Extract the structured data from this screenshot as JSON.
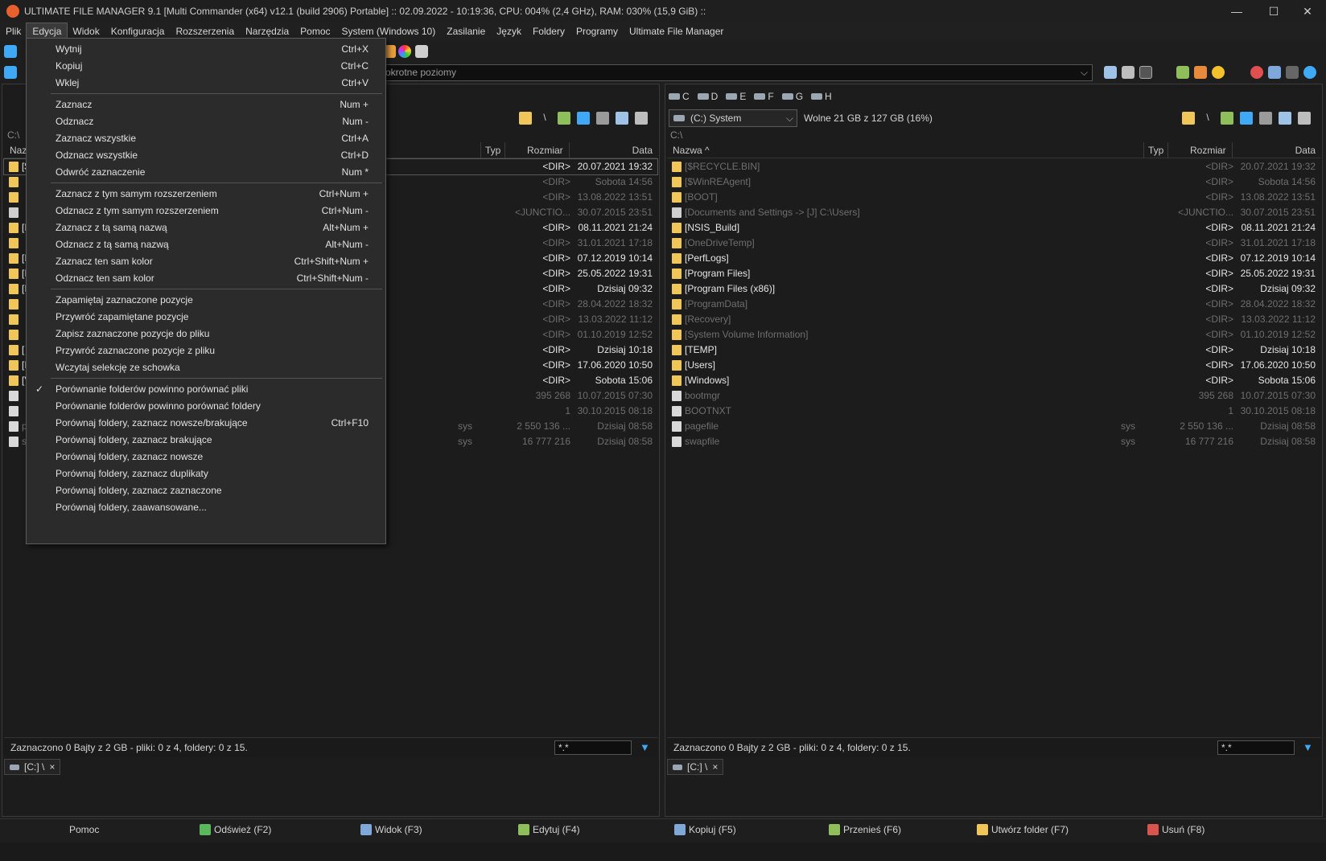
{
  "titlebar": {
    "title": "ULTIMATE FILE MANAGER 9.1 [Multi Commander (x64)  v12.1 (build 2906) Portable] :: 02.09.2022 - 10:19:36, CPU: 004% (2,4 GHz), RAM: 030% (15,9 GiB) ::",
    "minimize": "—",
    "maximize": "☐",
    "close": "✕"
  },
  "menubar": [
    "Plik",
    "Edycja",
    "Widok",
    "Konfiguracja",
    "Rozszerzenia",
    "Narzędzia",
    "Pomoc",
    "System (Windows 10)",
    "Zasilanie",
    "Język",
    "Foldery",
    "Programy",
    "Ultimate File Manager"
  ],
  "address": {
    "text": "okrotne poziomy"
  },
  "left_panel": {
    "path": "C:\\",
    "headers": {
      "name": "Naz",
      "type": "Typ",
      "size": "Rozmiar",
      "date": "Data"
    },
    "rows": [
      {
        "name": "[$",
        "type": "",
        "size": "<DIR>",
        "date": "20.07.2021 19:32",
        "style": "bright",
        "icon": "folder"
      },
      {
        "name": "",
        "type": "",
        "size": "<DIR>",
        "date": "Sobota 14:56",
        "style": "dim",
        "icon": "folder"
      },
      {
        "name": "",
        "type": "",
        "size": "<DIR>",
        "date": "13.08.2022 13:51",
        "style": "dim",
        "icon": "folder"
      },
      {
        "name": "",
        "type": "",
        "size": "<JUNCTIO...",
        "date": "30.07.2015 23:51",
        "style": "dim",
        "icon": "link"
      },
      {
        "name": "[I",
        "type": "",
        "size": "<DIR>",
        "date": "08.11.2021 21:24",
        "style": "bright",
        "icon": "folder"
      },
      {
        "name": "",
        "type": "",
        "size": "<DIR>",
        "date": "31.01.2021 17:18",
        "style": "dim",
        "icon": "folder"
      },
      {
        "name": "[I",
        "type": "",
        "size": "<DIR>",
        "date": "07.12.2019 10:14",
        "style": "bright",
        "icon": "folder"
      },
      {
        "name": "[I",
        "type": "",
        "size": "<DIR>",
        "date": "25.05.2022 19:31",
        "style": "bright",
        "icon": "folder"
      },
      {
        "name": "[I",
        "type": "",
        "size": "<DIR>",
        "date": "Dzisiaj 09:32",
        "style": "bright",
        "icon": "folder"
      },
      {
        "name": "",
        "type": "",
        "size": "<DIR>",
        "date": "28.04.2022 18:32",
        "style": "dim",
        "icon": "folder"
      },
      {
        "name": "",
        "type": "",
        "size": "<DIR>",
        "date": "13.03.2022 11:12",
        "style": "dim",
        "icon": "folder"
      },
      {
        "name": "",
        "type": "",
        "size": "<DIR>",
        "date": "01.10.2019 12:52",
        "style": "dim",
        "icon": "folder"
      },
      {
        "name": "[",
        "type": "",
        "size": "<DIR>",
        "date": "Dzisiaj 10:18",
        "style": "bright",
        "icon": "folder"
      },
      {
        "name": "[I",
        "type": "",
        "size": "<DIR>",
        "date": "17.06.2020 10:50",
        "style": "bright",
        "icon": "folder"
      },
      {
        "name": "[V",
        "type": "",
        "size": "<DIR>",
        "date": "Sobota 15:06",
        "style": "bright",
        "icon": "folder"
      },
      {
        "name": "",
        "type": "",
        "size": "395 268",
        "date": "10.07.2015 07:30",
        "style": "dim",
        "icon": "file"
      },
      {
        "name": "",
        "type": "",
        "size": "1",
        "date": "30.10.2015 08:18",
        "style": "dim",
        "icon": "file"
      },
      {
        "name": "p",
        "type": "sys",
        "size": "2 550 136 ...",
        "date": "Dzisiaj 08:58",
        "style": "dim",
        "icon": "file"
      },
      {
        "name": "s",
        "type": "sys",
        "size": "16 777 216",
        "date": "Dzisiaj 08:58",
        "style": "dim",
        "icon": "file"
      }
    ],
    "status": "Zaznaczono 0 Bajty z 2 GB - pliki: 0 z 4, foldery: 0 z 15.",
    "filter": "*.*",
    "tab": "[C:] \\",
    "tab_close": "×"
  },
  "right_panel": {
    "drives": [
      "C",
      "D",
      "E",
      "F",
      "G",
      "H"
    ],
    "drive_combo": "(C:) System",
    "free_space": "Wolne 21 GB z 127 GB (16%)",
    "path": "C:\\",
    "headers": {
      "name": "Nazwa ^",
      "type": "Typ",
      "size": "Rozmiar",
      "date": "Data"
    },
    "rows": [
      {
        "name": "[$RECYCLE.BIN]",
        "type": "",
        "size": "<DIR>",
        "date": "20.07.2021 19:32",
        "style": "dim",
        "icon": "folder"
      },
      {
        "name": "[$WinREAgent]",
        "type": "",
        "size": "<DIR>",
        "date": "Sobota 14:56",
        "style": "dim",
        "icon": "folder"
      },
      {
        "name": "[BOOT]",
        "type": "",
        "size": "<DIR>",
        "date": "13.08.2022 13:51",
        "style": "dim",
        "icon": "folder"
      },
      {
        "name": "[Documents and Settings ->  [J] C:\\Users]",
        "type": "",
        "size": "<JUNCTIO...",
        "date": "30.07.2015 23:51",
        "style": "dim",
        "icon": "link"
      },
      {
        "name": "[NSIS_Build]",
        "type": "",
        "size": "<DIR>",
        "date": "08.11.2021 21:24",
        "style": "bright",
        "icon": "folder"
      },
      {
        "name": "[OneDriveTemp]",
        "type": "",
        "size": "<DIR>",
        "date": "31.01.2021 17:18",
        "style": "dim",
        "icon": "folder"
      },
      {
        "name": "[PerfLogs]",
        "type": "",
        "size": "<DIR>",
        "date": "07.12.2019 10:14",
        "style": "bright",
        "icon": "folder"
      },
      {
        "name": "[Program Files]",
        "type": "",
        "size": "<DIR>",
        "date": "25.05.2022 19:31",
        "style": "bright",
        "icon": "folder"
      },
      {
        "name": "[Program Files (x86)]",
        "type": "",
        "size": "<DIR>",
        "date": "Dzisiaj 09:32",
        "style": "bright",
        "icon": "folder"
      },
      {
        "name": "[ProgramData]",
        "type": "",
        "size": "<DIR>",
        "date": "28.04.2022 18:32",
        "style": "dim",
        "icon": "folder"
      },
      {
        "name": "[Recovery]",
        "type": "",
        "size": "<DIR>",
        "date": "13.03.2022 11:12",
        "style": "dim",
        "icon": "folder"
      },
      {
        "name": "[System Volume Information]",
        "type": "",
        "size": "<DIR>",
        "date": "01.10.2019 12:52",
        "style": "dim",
        "icon": "folder"
      },
      {
        "name": "[TEMP]",
        "type": "",
        "size": "<DIR>",
        "date": "Dzisiaj 10:18",
        "style": "bright",
        "icon": "folder"
      },
      {
        "name": "[Users]",
        "type": "",
        "size": "<DIR>",
        "date": "17.06.2020 10:50",
        "style": "bright",
        "icon": "folder"
      },
      {
        "name": "[Windows]",
        "type": "",
        "size": "<DIR>",
        "date": "Sobota 15:06",
        "style": "bright",
        "icon": "folder"
      },
      {
        "name": "bootmgr",
        "type": "",
        "size": "395 268",
        "date": "10.07.2015 07:30",
        "style": "dim",
        "icon": "file"
      },
      {
        "name": "BOOTNXT",
        "type": "",
        "size": "1",
        "date": "30.10.2015 08:18",
        "style": "dim",
        "icon": "file"
      },
      {
        "name": "pagefile",
        "type": "sys",
        "size": "2 550 136 ...",
        "date": "Dzisiaj 08:58",
        "style": "dim",
        "icon": "file"
      },
      {
        "name": "swapfile",
        "type": "sys",
        "size": "16 777 216",
        "date": "Dzisiaj 08:58",
        "style": "dim",
        "icon": "file"
      }
    ],
    "status": "Zaznaczono 0 Bajty z 2 GB - pliki: 0 z 4, foldery: 0 z 15.",
    "filter": "*.*",
    "tab": "[C:] \\",
    "tab_close": "×"
  },
  "dropdown": {
    "groups": [
      [
        {
          "label": "Wytnij",
          "shortcut": "Ctrl+X"
        },
        {
          "label": "Kopiuj",
          "shortcut": "Ctrl+C"
        },
        {
          "label": "Wklej",
          "shortcut": "Ctrl+V"
        }
      ],
      [
        {
          "label": "Zaznacz",
          "shortcut": "Num +"
        },
        {
          "label": "Odznacz",
          "shortcut": "Num -"
        },
        {
          "label": "Zaznacz wszystkie",
          "shortcut": "Ctrl+A"
        },
        {
          "label": "Odznacz wszystkie",
          "shortcut": "Ctrl+D"
        },
        {
          "label": "Odwróć zaznaczenie",
          "shortcut": "Num *"
        }
      ],
      [
        {
          "label": "Zaznacz z tym samym rozszerzeniem",
          "shortcut": "Ctrl+Num +"
        },
        {
          "label": "Odznacz z tym samym rozszerzeniem",
          "shortcut": "Ctrl+Num -"
        },
        {
          "label": "Zaznacz z tą samą nazwą",
          "shortcut": "Alt+Num +"
        },
        {
          "label": "Odznacz z tą samą nazwą",
          "shortcut": "Alt+Num -"
        },
        {
          "label": "Zaznacz ten sam kolor",
          "shortcut": "Ctrl+Shift+Num +"
        },
        {
          "label": "Odznacz ten sam kolor",
          "shortcut": "Ctrl+Shift+Num -"
        }
      ],
      [
        {
          "label": "Zapamiętaj zaznaczone pozycje",
          "shortcut": ""
        },
        {
          "label": "Przywróć zapamiętane pozycje",
          "shortcut": ""
        },
        {
          "label": "Zapisz zaznaczone pozycje do pliku",
          "shortcut": ""
        },
        {
          "label": "Przywróć zaznaczone pozycje z pliku",
          "shortcut": ""
        },
        {
          "label": "Wczytaj selekcję ze schowka",
          "shortcut": ""
        }
      ],
      [
        {
          "label": "Porównanie folderów powinno porównać pliki",
          "shortcut": "",
          "checked": true
        },
        {
          "label": "Porównanie folderów powinno porównać foldery",
          "shortcut": ""
        },
        {
          "label": "Porównaj foldery, zaznacz nowsze/brakujące",
          "shortcut": "Ctrl+F10"
        },
        {
          "label": "Porównaj foldery, zaznacz brakujące",
          "shortcut": ""
        },
        {
          "label": "Porównaj foldery, zaznacz nowsze",
          "shortcut": ""
        },
        {
          "label": "Porównaj foldery, zaznacz duplikaty",
          "shortcut": ""
        },
        {
          "label": "Porównaj foldery, zaznacz zaznaczone",
          "shortcut": ""
        },
        {
          "label": "Porównaj foldery, zaawansowane...",
          "shortcut": ""
        }
      ]
    ],
    "check_glyph": "✓"
  },
  "fnbar": [
    {
      "label": "Pomoc",
      "icon": "help-icon",
      "color": ""
    },
    {
      "label": "Odśwież (F2)",
      "icon": "refresh-icon",
      "color": "#5cb85c"
    },
    {
      "label": "Widok (F3)",
      "icon": "view-icon",
      "color": "#7fa7d8"
    },
    {
      "label": "Edytuj (F4)",
      "icon": "edit-icon",
      "color": "#8fbf5a"
    },
    {
      "label": "Kopiuj (F5)",
      "icon": "copy-icon",
      "color": "#7fa7d8"
    },
    {
      "label": "Przenieś (F6)",
      "icon": "move-icon",
      "color": "#8fbf5a"
    },
    {
      "label": "Utwórz folder (F7)",
      "icon": "new-folder-icon",
      "color": "#f1c659"
    },
    {
      "label": "Usuń (F8)",
      "icon": "delete-icon",
      "color": "#d9534f"
    }
  ],
  "colors": {
    "folder": "#f1c659",
    "accent": "#3fa9f5",
    "app_icon": "#e8602c"
  }
}
